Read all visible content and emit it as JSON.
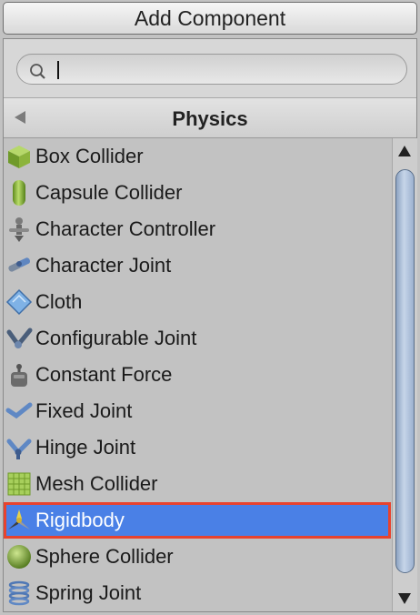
{
  "top_button": {
    "label": "Add Component"
  },
  "search": {
    "value": "",
    "placeholder": ""
  },
  "header": {
    "title": "Physics"
  },
  "items": [
    {
      "label": "Box Collider",
      "icon": "box-collider-icon"
    },
    {
      "label": "Capsule Collider",
      "icon": "capsule-collider-icon"
    },
    {
      "label": "Character Controller",
      "icon": "character-controller-icon"
    },
    {
      "label": "Character Joint",
      "icon": "character-joint-icon"
    },
    {
      "label": "Cloth",
      "icon": "cloth-icon"
    },
    {
      "label": "Configurable Joint",
      "icon": "configurable-joint-icon"
    },
    {
      "label": "Constant Force",
      "icon": "constant-force-icon"
    },
    {
      "label": "Fixed Joint",
      "icon": "fixed-joint-icon"
    },
    {
      "label": "Hinge Joint",
      "icon": "hinge-joint-icon"
    },
    {
      "label": "Mesh Collider",
      "icon": "mesh-collider-icon"
    },
    {
      "label": "Rigidbody",
      "icon": "rigidbody-icon",
      "selected": true
    },
    {
      "label": "Sphere Collider",
      "icon": "sphere-collider-icon"
    },
    {
      "label": "Spring Joint",
      "icon": "spring-joint-icon"
    }
  ],
  "colors": {
    "selection": "#4a80e6",
    "highlight_border": "#e8432e"
  }
}
